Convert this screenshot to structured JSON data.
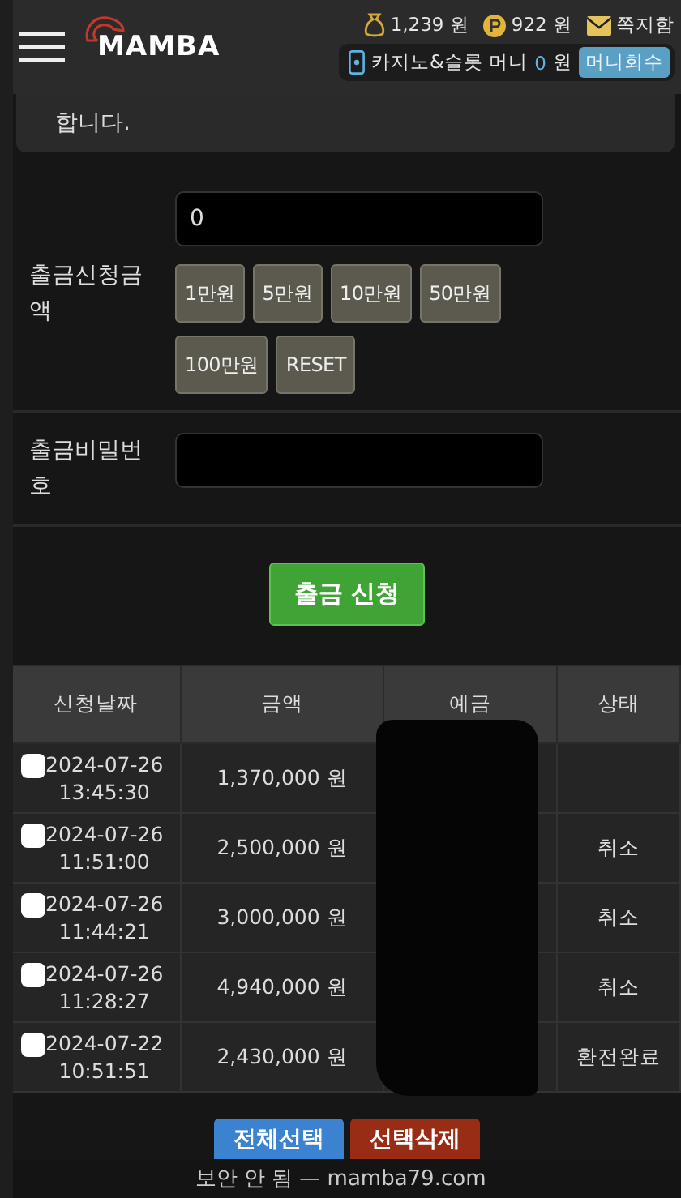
{
  "header": {
    "logo": "MAMBA",
    "balance": "1,239 원",
    "points": "922 원",
    "messages": "쪽지함",
    "casino_label": "카지노&슬롯 머니",
    "casino_amount": "0",
    "casino_unit": "원",
    "collect_button": "머니회수"
  },
  "notice": {
    "text": "합니다."
  },
  "form": {
    "amount_label": "출금신청금액",
    "amount_value": "0",
    "amount_buttons": [
      "1만원",
      "5만원",
      "10만원",
      "50만원",
      "100만원",
      "RESET"
    ],
    "password_label": "출금비밀번호",
    "submit": "출금 신청"
  },
  "table": {
    "columns": [
      "신청날짜",
      "금액",
      "예금",
      "상태"
    ],
    "rows": [
      {
        "checked": false,
        "date": "2024-07-26",
        "time": "13:45:30",
        "amount": "1,370,000 원"
      },
      {
        "checked": false,
        "date": "2024-07-26",
        "time": "11:51:00",
        "amount": "2,500,000 원",
        "status": "취소"
      },
      {
        "checked": false,
        "date": "2024-07-26",
        "time": "11:44:21",
        "amount": "3,000,000 원",
        "status": "취소"
      },
      {
        "checked": false,
        "date": "2024-07-26",
        "time": "11:28:27",
        "amount": "4,940,000 원",
        "status": "취소"
      },
      {
        "checked": false,
        "date": "2024-07-22",
        "time": "10:51:51",
        "amount": "2,430,000 원",
        "status": "환전완료"
      }
    ]
  },
  "actions": {
    "select_all": "전체선택",
    "delete_selected": "선택삭제"
  },
  "url_bar": {
    "text": "보안 안 됨 — mamba79.com"
  }
}
